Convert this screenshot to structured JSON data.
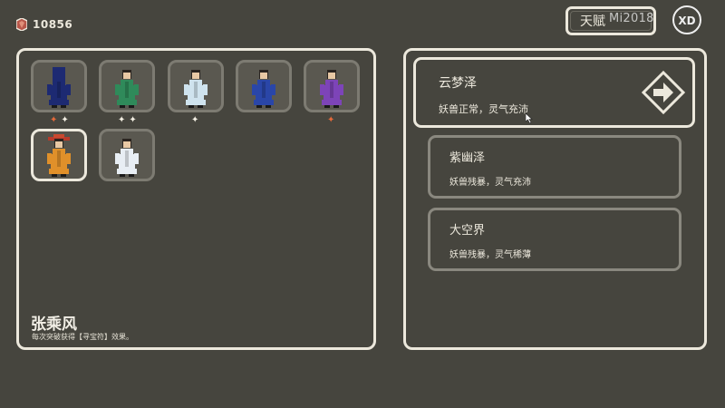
{
  "currency": {
    "icon": "gem-icon",
    "amount": "10856"
  },
  "talent": {
    "label": "天赋"
  },
  "watermark": {
    "text": "Mi2018"
  },
  "characters": [
    {
      "id": "c1",
      "name": "",
      "icon": "hooded-cloak-icon",
      "robe": "#1d2a72",
      "stars": [
        "red",
        "white"
      ]
    },
    {
      "id": "c2",
      "name": "",
      "icon": "green-robe-icon",
      "robe": "#2f8a5a",
      "stars": [
        "white",
        "white"
      ]
    },
    {
      "id": "c3",
      "name": "",
      "icon": "white-robe-icon",
      "robe": "#cfe3ee",
      "stars": [
        "white"
      ]
    },
    {
      "id": "c4",
      "name": "",
      "icon": "blue-robe-icon",
      "robe": "#2a46a8",
      "stars": []
    },
    {
      "id": "c5",
      "name": "",
      "icon": "purple-robe-icon",
      "robe": "#7d44b8",
      "stars": [
        "red"
      ]
    },
    {
      "id": "c6",
      "name": "",
      "icon": "straw-hat-icon",
      "robe": "#e0902a",
      "stars": []
    },
    {
      "id": "c7",
      "name": "",
      "icon": "scholar-robe-icon",
      "robe": "#e8eef4",
      "stars": []
    }
  ],
  "selected": {
    "name": "张乘风",
    "description": "每次突破获得【寻宝符】效果。"
  },
  "maps": [
    {
      "title": "云梦泽",
      "description": "妖兽正常，灵气充沛"
    },
    {
      "title": "紫幽泽",
      "description": "妖兽残暴，灵气充沛"
    },
    {
      "title": "大空界",
      "description": "妖兽残暴，灵气稀薄"
    }
  ],
  "colors": {
    "background": "#46453e",
    "frame": "#ece8dc",
    "red_star": "#e56a3a"
  }
}
